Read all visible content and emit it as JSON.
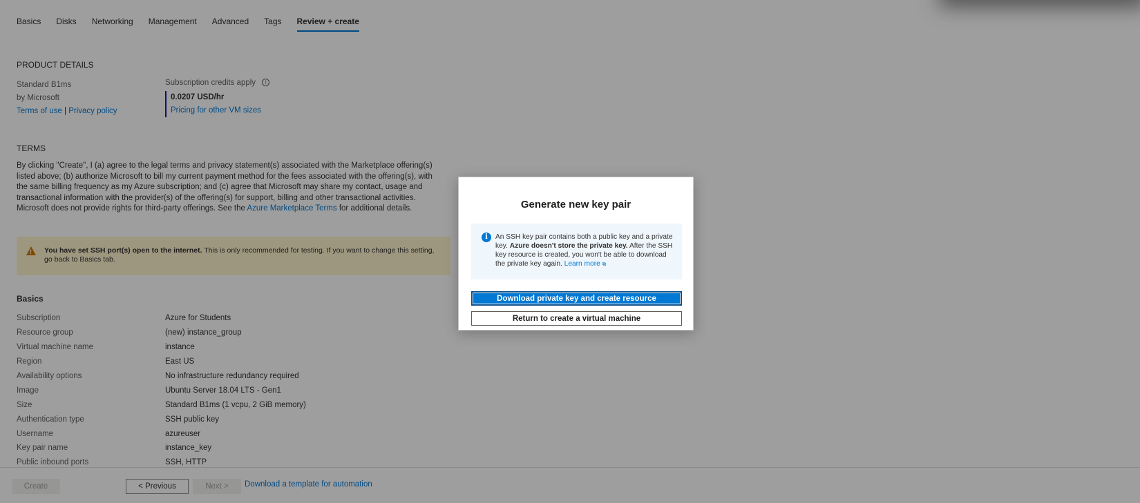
{
  "tabs": [
    {
      "label": "Basics"
    },
    {
      "label": "Disks"
    },
    {
      "label": "Networking"
    },
    {
      "label": "Management"
    },
    {
      "label": "Advanced"
    },
    {
      "label": "Tags"
    },
    {
      "label": "Review + create"
    }
  ],
  "active_tab": "Review + create",
  "product": {
    "section_title": "PRODUCT DETAILS",
    "name": "Standard B1ms",
    "publisher": "by Microsoft",
    "terms_link": "Terms of use",
    "separator": "|",
    "privacy_link": "Privacy policy",
    "credits_label": "Subscription credits apply",
    "info_glyph": "i",
    "price": "0.0207 USD/hr",
    "pricing_link": "Pricing for other VM sizes"
  },
  "terms": {
    "section_title": "TERMS",
    "text_before": "By clicking \"Create\", I (a) agree to the legal terms and privacy statement(s) associated with the Marketplace offering(s) listed above; (b) authorize Microsoft to bill my current payment method for the fees associated with the offering(s), with the same billing frequency as my Azure subscription; and (c) agree that Microsoft may share my contact, usage and transactional information with the provider(s) of the offering(s) for support, billing and other transactional activities. Microsoft does not provide rights for third-party offerings. See the ",
    "link": "Azure Marketplace Terms",
    "text_after": " for additional details."
  },
  "warning": {
    "icon": "warning-icon",
    "bold": "You have set SSH port(s) open to the internet.",
    "text": "  This is only recommended for testing.  If you want to change this setting, go back to Basics tab."
  },
  "basics": {
    "title": "Basics",
    "rows": [
      {
        "key": "Subscription",
        "value": "Azure for Students"
      },
      {
        "key": "Resource group",
        "value": "(new) instance_group"
      },
      {
        "key": "Virtual machine name",
        "value": "instance"
      },
      {
        "key": "Region",
        "value": "East US"
      },
      {
        "key": "Availability options",
        "value": "No infrastructure redundancy required"
      },
      {
        "key": "Image",
        "value": "Ubuntu Server 18.04 LTS - Gen1"
      },
      {
        "key": "Size",
        "value": "Standard B1ms (1 vcpu, 2 GiB memory)"
      },
      {
        "key": "Authentication type",
        "value": "SSH public key"
      },
      {
        "key": "Username",
        "value": "azureuser"
      },
      {
        "key": "Key pair name",
        "value": "instance_key"
      },
      {
        "key": "Public inbound ports",
        "value": "SSH, HTTP"
      }
    ]
  },
  "footer": {
    "create": "Create",
    "previous": "< Previous",
    "next": "Next >",
    "template_link": "Download a template for automation"
  },
  "dialog": {
    "title": "Generate new key pair",
    "info_glyph": "i",
    "info_text_1": "An SSH key pair contains both a public key and a private key. ",
    "info_bold": "Azure doesn't store the private key.",
    "info_text_2": " After the SSH key resource is created, you won't be able to download the private key again. ",
    "learn_more": "Learn more",
    "external_glyph": "⧉",
    "primary_button": "Download private key and create resource",
    "secondary_button": "Return to create a virtual machine"
  },
  "colors": {
    "accent": "#0078d4",
    "warning_bg": "#fff4ce",
    "info_bg": "#eff6fc"
  }
}
